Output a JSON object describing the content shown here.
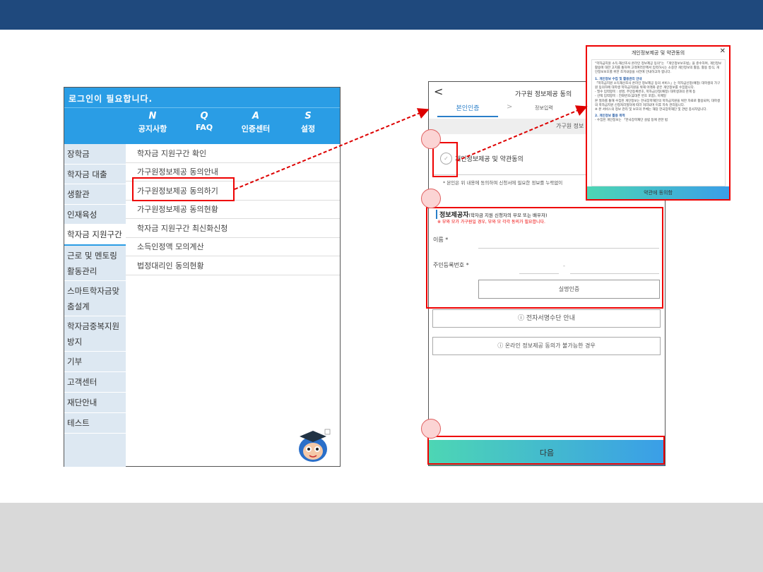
{
  "left_phone": {
    "header": "로그인이 필요합니다.",
    "nav": [
      {
        "key": "N",
        "label": "공지사항"
      },
      {
        "key": "Q",
        "label": "FAQ"
      },
      {
        "key": "A",
        "label": "인증센터"
      },
      {
        "key": "S",
        "label": "설정"
      }
    ],
    "sidebar": [
      "장학금",
      "학자금 대출",
      "생활관",
      "인재육성",
      "학자금 지원구간",
      "근로 및 멘토링 활동관리",
      "스마트학자금맞춤설계",
      "학자금중복지원방지",
      "기부",
      "고객센터",
      "재단안내",
      "테스트"
    ],
    "menu": [
      "학자금 지원구간 확인",
      "가구원정보제공 동의안내",
      "가구원정보제공 동의하기",
      "가구원정보제공 동의현황",
      "학자금 지원구간 최신화신청",
      "소득인정액 모의계산",
      "법정대리인 동의현황"
    ]
  },
  "right_phone": {
    "back": "<",
    "title": "가구원 정보제공 동의",
    "tab_active": "본인인증",
    "tab_chevron": ">",
    "tab_next": "정보입력",
    "gray_bar": "가구원 정보",
    "consent_label": "개인정보제공 및 약관동의",
    "consent_check": "✓",
    "note": "* 본인은 위 내용에 동의하며 신청서에 필요한 정보를 누락없이",
    "section_title": "정보제공자",
    "section_sub": "(학자금 지원 신청자의 부모 또는 배우자)",
    "section_warn": "※ 부와 모가 가구원일 경우, 부와 모 각각 동의가 필요합니다.",
    "name_label": "이름 *",
    "ssn_label": "주민등록번호 *",
    "ssn_dash": "-",
    "verify_button": "실명인증",
    "esign_button": "ⓘ 전자서명수단 안내",
    "offline_button": "ⓘ 온라인 정보제공 동의가 불가능한 경우",
    "next_button": "다음"
  },
  "popup": {
    "title": "개인정보제공 및 약관동의",
    "close": "✕",
    "intro": "\"학자금지원 소득·재산조사 온라인 정보제공 동의\"는 「개인정보보호법」을 준수하며, 개인정보활용에 대한 고지를 통하여 고객여러분께서 입력하시는 소중한 개인정보의 활용, 활용 방식, 개인정보보호를 위한 조치내용을 사전에 안내하고자 합니다.",
    "heading1": "1. 개인정보 수집 및 활용관리 안내",
    "p1": "「학자금지원 소득재산조사 온라인 정보제공 동의 서비스」는 학자금신청(예정) 대학생의 가구원 동의하에 대학생 학자금지원을 위해 아래와 같은 개인정보를 수집합니다.",
    "bullet1": "- 필수 입력항목 : 성명, 주민등록번호, 학자금신청(예정) 대학생과의 관계 등",
    "bullet2": "- 선택 입력항목 : 전화번호(휴대폰 번호 포함), 이메일",
    "p2": "본 절차를 통해 수집된 개인정보는 한국장학재단의 학자금지원을 위한 자료로 활용되며, 대학생의 학자금지원 신청처리절차에 따라 처리되며 이후 지속 관리됩니다.",
    "p3": "※ 본 서비스의 정보 관리 및 보호의 주체는 해당 한국장학재단 및 관련 종사자입니다.",
    "heading2": "2. 개인정보 활용 목적",
    "p4": "- 수집된 개인정보는 「한국장학재단 설립 등에 관한 법",
    "agree_button": "약관에 동의함"
  }
}
